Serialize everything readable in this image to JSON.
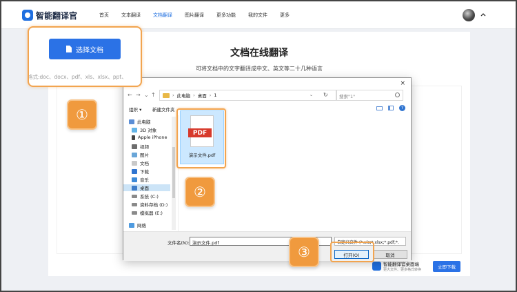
{
  "header": {
    "logo_text": "智能翻译官",
    "nav": [
      {
        "label": "首页"
      },
      {
        "label": "文本翻译"
      },
      {
        "label": "文档翻译"
      },
      {
        "label": "图片翻译"
      },
      {
        "label": "更多功能"
      },
      {
        "label": "我的文件"
      },
      {
        "label": "更多"
      }
    ],
    "active_nav": "文档翻译",
    "accent_color": "#1f6fe0"
  },
  "main": {
    "title": "文档在线翻译",
    "subtitle": "可将文档中的文字翻译成中文、英文等二十几种语言",
    "select_button": "选择文档",
    "formats": "格式:doc、docx、pdf、xls、xlsx、ppt、"
  },
  "steps": [
    "①",
    "②",
    "③"
  ],
  "dialog": {
    "close": "×",
    "breadcrumb": [
      "此电脑",
      "桌面",
      "1"
    ],
    "search_placeholder": "搜索\"1\"",
    "organize": "组织 ▾",
    "new_folder": "新建文件夹",
    "tree": [
      {
        "label": "此电脑",
        "icon": "computer-icon"
      },
      {
        "label": "3D 对象",
        "icon": "cube-icon"
      },
      {
        "label": "Apple iPhone",
        "icon": "phone-icon"
      },
      {
        "label": "视频",
        "icon": "video-icon"
      },
      {
        "label": "图片",
        "icon": "image-icon"
      },
      {
        "label": "文档",
        "icon": "document-icon"
      },
      {
        "label": "下载",
        "icon": "download-icon"
      },
      {
        "label": "音乐",
        "icon": "music-icon"
      },
      {
        "label": "桌面",
        "icon": "desktop-icon"
      },
      {
        "label": "系统 (C:)",
        "icon": "drive-icon"
      },
      {
        "label": "资料存档 (D:)",
        "icon": "drive-icon"
      },
      {
        "label": "模拟器 (E:)",
        "icon": "drive-icon"
      },
      {
        "label": "网络",
        "icon": "network-icon"
      }
    ],
    "file": {
      "name": "演示文件.pdf",
      "badge": "PDF"
    },
    "filename_label": "文件名(N):",
    "filename_value": "演示文件.pdf",
    "filter": "自定义文件 (*.xls;*.xlsx;*.pdf;*.",
    "open_button": "打开(O)",
    "cancel_button": "取消"
  },
  "promo": {
    "title": "智能翻译官桌面端",
    "subtitle": "更大文件、更多格式转换",
    "button": "立即下载"
  }
}
